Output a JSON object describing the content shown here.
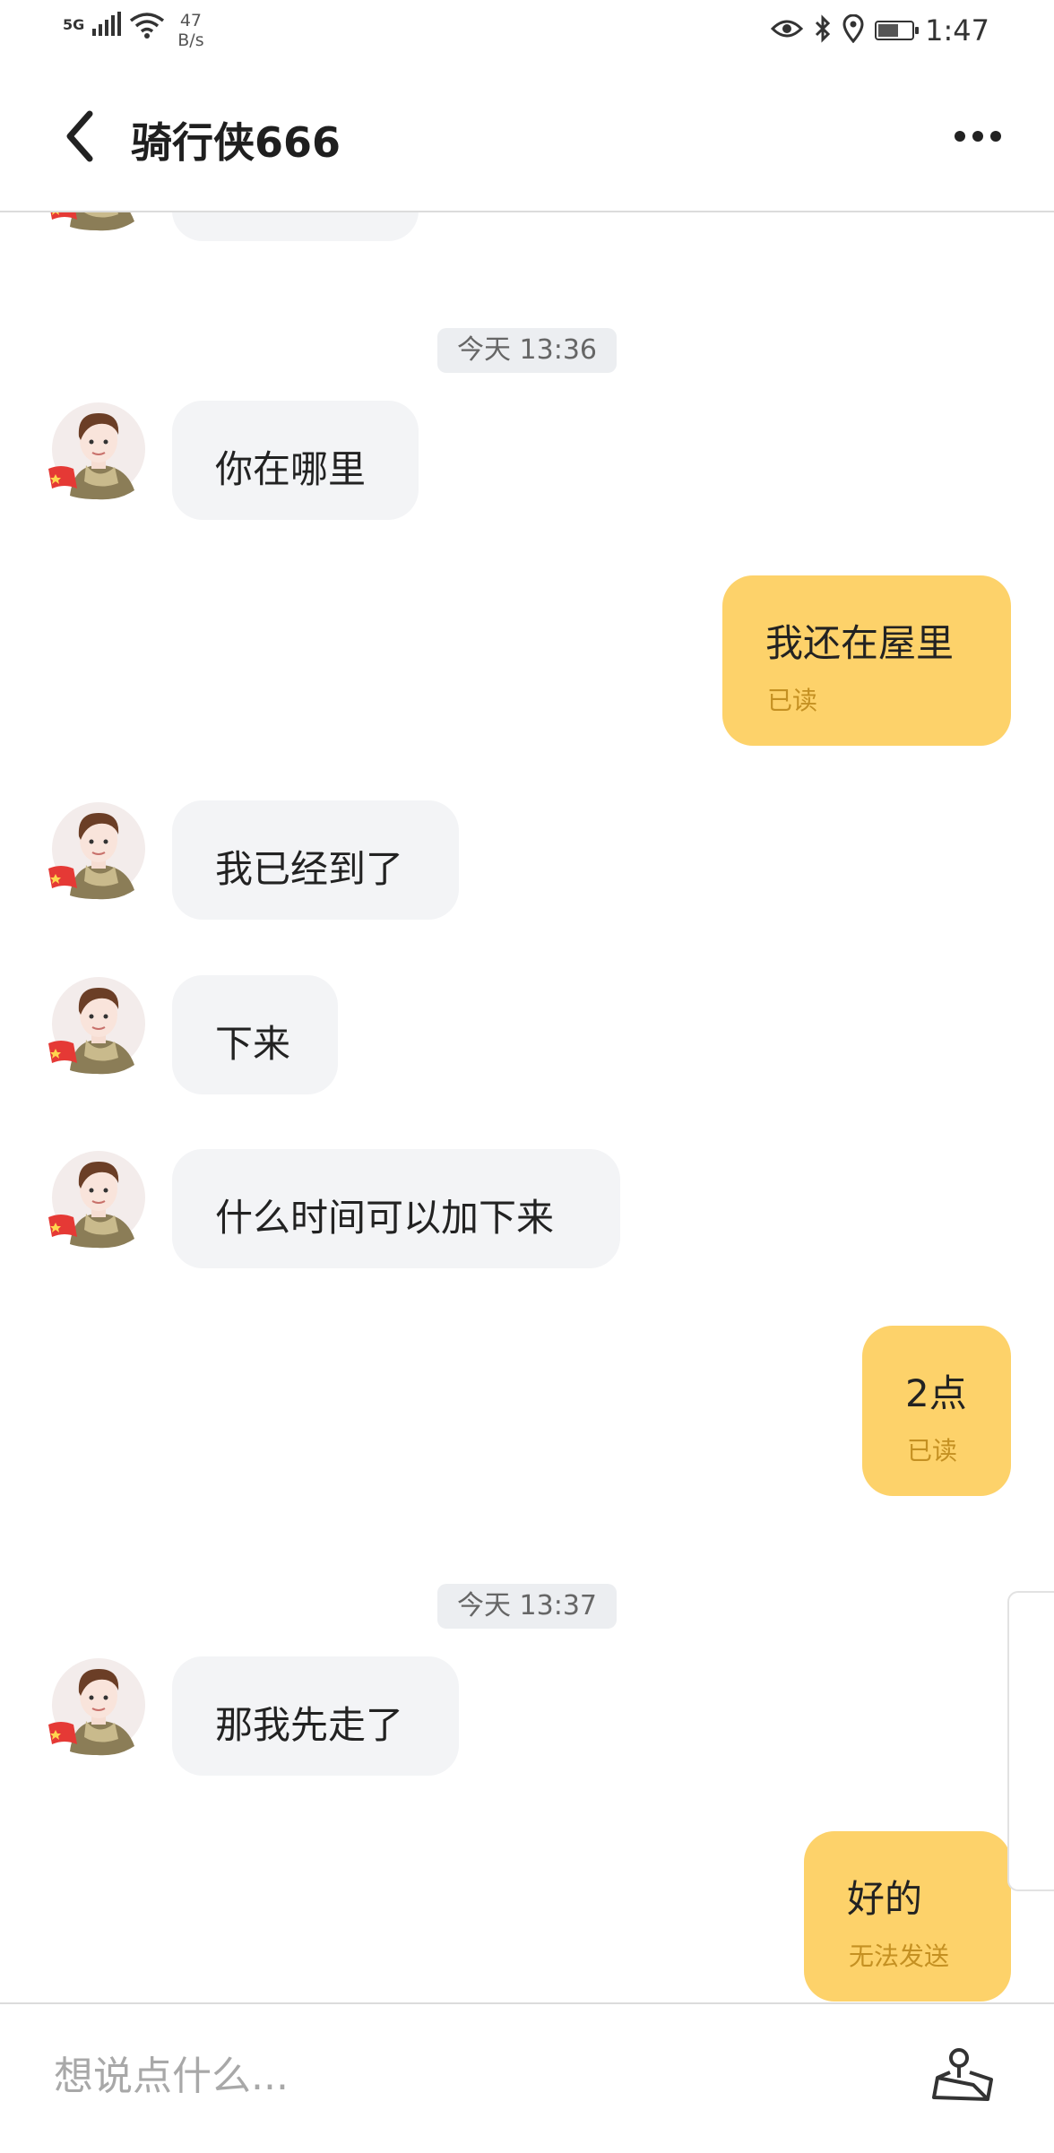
{
  "status_bar": {
    "network": "5G",
    "speed_value": "47",
    "speed_unit": "B/s",
    "time": "1:47",
    "battery_level": 0.6,
    "icons": [
      "signal-icon",
      "wifi-icon",
      "eye-icon",
      "bluetooth-icon",
      "location-pin-icon",
      "battery-icon"
    ]
  },
  "header": {
    "title": "骑行侠666",
    "back_icon": "chevron-left-icon",
    "more_icon": "more-icon"
  },
  "chat": {
    "messages": [
      {
        "type": "partial",
        "side": "left"
      },
      {
        "type": "time",
        "text": "今天 13:36"
      },
      {
        "type": "msg",
        "side": "left",
        "text": "你在哪里"
      },
      {
        "type": "msg",
        "side": "right",
        "text": "我还在屋里",
        "status": "已读"
      },
      {
        "type": "msg",
        "side": "left",
        "text": "我已经到了"
      },
      {
        "type": "msg",
        "side": "left",
        "text": "下来"
      },
      {
        "type": "msg",
        "side": "left",
        "text": "什么时间可以加下来"
      },
      {
        "type": "msg",
        "side": "right",
        "text": "2点",
        "status": "已读"
      },
      {
        "type": "time",
        "text": "今天 13:37"
      },
      {
        "type": "msg",
        "side": "left",
        "text": "那我先走了"
      },
      {
        "type": "msg",
        "side": "right",
        "text": "好的",
        "status": "无法发送"
      }
    ]
  },
  "input": {
    "placeholder": "想说点什么...",
    "value": "",
    "location_icon": "location-share-icon"
  },
  "colors": {
    "sent_bubble": "#fdd26a",
    "received_bubble": "#f3f4f6",
    "status_text": "#c49022",
    "timestamp_bg": "#eceef1"
  }
}
